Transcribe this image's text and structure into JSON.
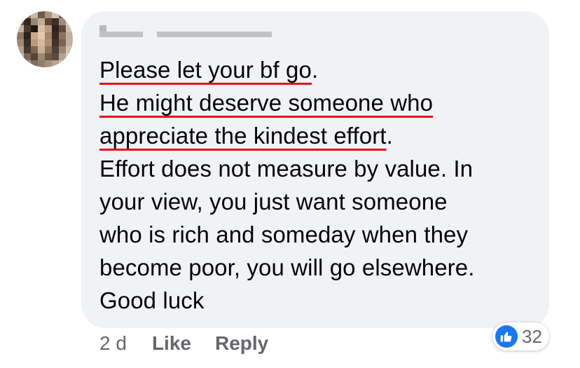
{
  "comment": {
    "author_name": "",
    "lines": [
      "Please let your bf go",
      ".",
      "He might deserve someone who",
      "appreciate the kindest effort",
      ".",
      "Effort does not measure by value. In",
      "your view, you just want someone",
      "who is rich and someday when they",
      "become poor, you will go elsewhere.",
      "Good luck"
    ],
    "underline_color": "#e0131b"
  },
  "footer": {
    "timestamp": "2 d",
    "like_label": "Like",
    "reply_label": "Reply"
  },
  "reactions": {
    "icon": "thumbs-up-icon",
    "count": "32",
    "color": "#1877f2"
  },
  "colors": {
    "bubble": "#f0f2f5",
    "text": "#050505",
    "meta": "#65676b"
  }
}
